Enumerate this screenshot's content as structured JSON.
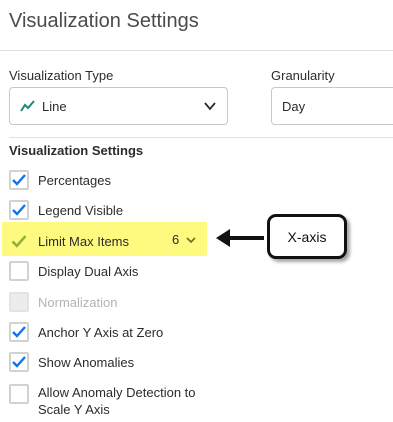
{
  "page": {
    "title": "Visualization Settings"
  },
  "visualization_type": {
    "label": "Visualization Type",
    "value": "Line",
    "icon": "line-chart-icon"
  },
  "granularity": {
    "label": "Granularity",
    "value": "Day"
  },
  "settings": {
    "heading": "Visualization Settings",
    "percentages": {
      "label": "Percentages",
      "checked": true
    },
    "legend_visible": {
      "label": "Legend Visible",
      "checked": true
    },
    "limit_max_items": {
      "label": "Limit Max Items",
      "checked": true,
      "value": "6"
    },
    "display_dual_axis": {
      "label": "Display Dual Axis",
      "checked": false
    },
    "normalization": {
      "label": "Normalization",
      "checked": false,
      "disabled": true
    },
    "anchor_y_axis": {
      "label": "Anchor Y Axis at Zero",
      "checked": true
    },
    "show_anomalies": {
      "label": "Show Anomalies",
      "checked": true
    },
    "allow_anomaly_line1": "Allow Anomaly Detection to",
    "allow_anomaly_line2": "Scale Y Axis"
  },
  "annotation": {
    "text": "X-axis"
  },
  "colors": {
    "accent": "#1473e6",
    "highlight": "#fdfa7f",
    "highlight_check": "#8fb33a"
  }
}
